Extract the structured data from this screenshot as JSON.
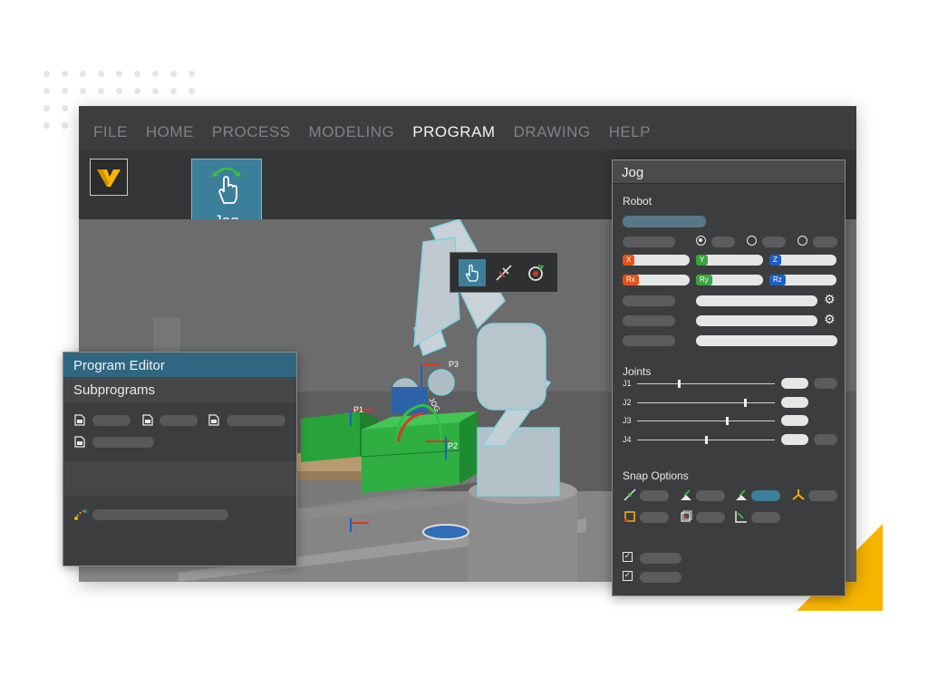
{
  "menu": {
    "items": [
      {
        "label": "FILE",
        "active": false
      },
      {
        "label": "HOME",
        "active": false
      },
      {
        "label": "PROCESS",
        "active": false
      },
      {
        "label": "MODELING",
        "active": false
      },
      {
        "label": "PROGRAM",
        "active": true
      },
      {
        "label": "DRAWING",
        "active": false
      },
      {
        "label": "HELP",
        "active": false
      }
    ]
  },
  "ribbon": {
    "jog_button_label": "Jog"
  },
  "viewport": {
    "points": [
      "P1",
      "P2",
      "P3"
    ],
    "gizmo_label": "JOG"
  },
  "program_editor": {
    "title": "Program Editor",
    "subtitle": "Subprograms"
  },
  "jog_panel": {
    "title": "Jog",
    "robot_section": "Robot",
    "axis_tags": [
      "X",
      "Y",
      "Z",
      "Rx",
      "Ry",
      "Rz"
    ],
    "joints_section": "Joints",
    "joints": [
      {
        "label": "J1",
        "value": 0.3
      },
      {
        "label": "J2",
        "value": 0.78
      },
      {
        "label": "J3",
        "value": 0.65
      },
      {
        "label": "J4",
        "value": 0.5
      }
    ],
    "snap_section": "Snap Options"
  },
  "colors": {
    "accent": "#3c7f9a",
    "brand_yellow": "#f7b500",
    "tag_red": "#e2541c",
    "tag_green": "#3aa53f",
    "tag_blue": "#1f5fc4"
  }
}
